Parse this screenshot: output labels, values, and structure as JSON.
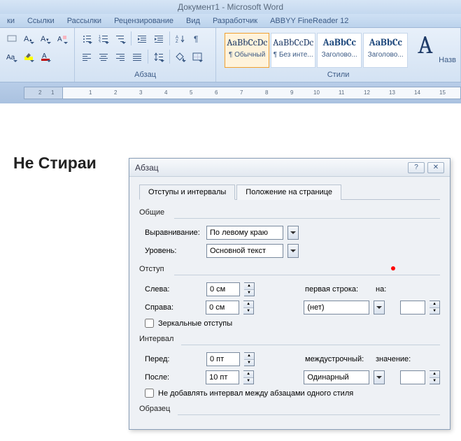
{
  "title": "Документ1 - Microsoft Word",
  "tabs": [
    "ки",
    "Ссылки",
    "Рассылки",
    "Рецензирование",
    "Вид",
    "Разработчик",
    "ABBYY FineReader 12"
  ],
  "ribbon": {
    "group_para": "Абзац",
    "group_styles": "Стили",
    "styles": [
      {
        "prev": "AaBbCcDc",
        "name": "¶ Обычный",
        "sel": true
      },
      {
        "prev": "AaBbCcDc",
        "name": "¶ Без инте...",
        "sel": false
      },
      {
        "prev": "AaBbCc",
        "name": "Заголово...",
        "sel": false,
        "blue": true
      },
      {
        "prev": "AaBbCc",
        "name": "Заголово...",
        "sel": false,
        "blue": true
      }
    ],
    "change_styles_prefix": "Назв"
  },
  "body_text": "Не Стираи",
  "dialog": {
    "title": "Абзац",
    "tab1": "Отступы и интервалы",
    "tab2": "Положение на странице",
    "sec_general": "Общие",
    "align_label": "Выравнивание:",
    "align_value": "По левому краю",
    "level_label": "Уровень:",
    "level_value": "Основной текст",
    "sec_indent": "Отступ",
    "left_label": "Слева:",
    "left_value": "0 см",
    "right_label": "Справа:",
    "right_value": "0 см",
    "firstline_label": "первая строка:",
    "firstline_value": "(нет)",
    "by_label": "на:",
    "by_value": "",
    "mirror": "Зеркальные отступы",
    "sec_spacing": "Интервал",
    "before_label": "Перед:",
    "before_value": "0 пт",
    "after_label": "После:",
    "after_value": "10 пт",
    "linesp_label": "междустрочный:",
    "linesp_value": "Одинарный",
    "val_label": "значение:",
    "val_value": "",
    "noadd": "Не добавлять интервал между абзацами одного стиля",
    "sec_sample": "Образец"
  }
}
